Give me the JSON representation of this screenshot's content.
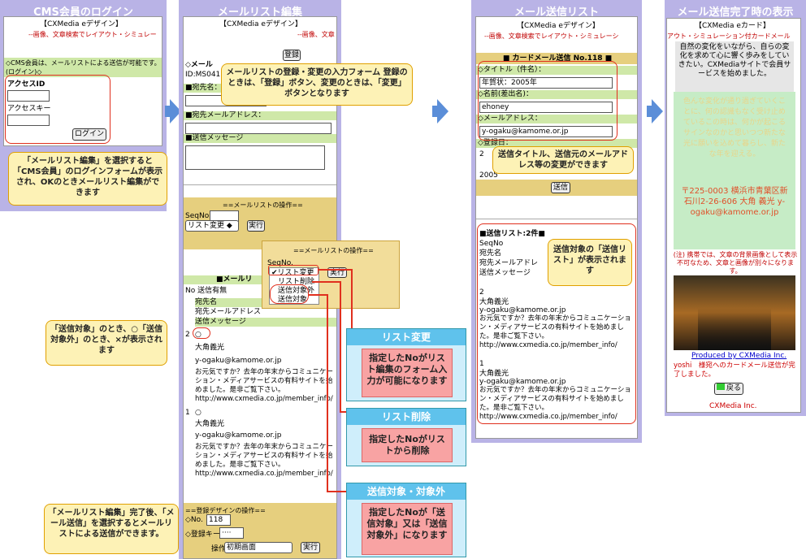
{
  "col1": {
    "title": "CMS会員のログイン",
    "header": "【CXMedia eデザイン】",
    "subheader": "--画像、文章検索でレイアウト・シミュレー",
    "notice": "◇CMS会員は、メールリストによる送信が可能です。(ログイン)◇",
    "access_id_label": "アクセスID",
    "access_key_label": "アクセスキー",
    "login_button": "ログイン",
    "callout": "「メールリスト編集」を選択すると「CMS会員」のログインフォームが表示され、OKのときメールリスト編集ができます"
  },
  "col2": {
    "title": "メールリスト編集",
    "header": "【CXMedia eデザイン】",
    "subheader": "--画像、文章",
    "register_button": "登録",
    "maillist_label": "◇メール",
    "id_text": "ID:MS041",
    "name_label": "■宛先名：",
    "email_label": "■宛先メールアドレス：",
    "message_label": "■送信メッセージ",
    "callout": "メールリストの登録・変更の入力フォーム 登録のときは、「登録」ボタン、変更のときは、「変更」ボタンとなります",
    "ops_title": "==メールリストの操作==",
    "seqno_label": "SeqNo.",
    "select_value": "リスト変更",
    "exec_button": "実行",
    "list_header": "■メールリ",
    "col_header": "No 送信有無",
    "col_name": "宛先名",
    "col_email": "宛先メールアドレス",
    "col_msg": "送信メッセージ",
    "entries": [
      {
        "no": "2",
        "mark": "○",
        "name": "大角義光",
        "email": "y-ogaku@kamome.or.jp",
        "body": "お元気ですか？去年の年末からコミュニケーション・メディアサービスの有料サイトを始めました。是非ご覧下さい。http://www.cxmedia.co.jp/member_info/"
      },
      {
        "no": "1",
        "mark": "○",
        "name": "大角義光",
        "email": "y-ogaku@kamome.or.jp",
        "body": "お元気ですか？去年の年末からコミュニケーション・メディアサービスの有料サイトを始めました。是非ご覧下さい。http://www.cxmedia.co.jp/member_info/"
      }
    ],
    "footer_title": "==登録デザインの操作==",
    "footer_no_label": "◇No.",
    "footer_no_value": "118",
    "footer_key_label": "◇登録キー",
    "footer_key_value": "····",
    "footer_op_label": "操作",
    "footer_select": "初期画面",
    "footer_exec": "実行",
    "callout_mark": "「送信対象」のとき、○「送信対象外」のとき、×が表示されます",
    "callout_send": "「メールリスト編集」完了後、「メール送信」を選択するとメールリストによる送信ができます。"
  },
  "popup": {
    "title": "==メールリストの操作==",
    "seqno_label": "SeqNo.",
    "options": [
      "✔リスト変更",
      "リスト削除",
      "送信対象外",
      "送信対象"
    ],
    "exec_button": "実行"
  },
  "info": [
    {
      "title": "リスト変更",
      "body": "指定したNoがリスト編集のフォーム入力が可能になります"
    },
    {
      "title": "リスト削除",
      "body": "指定したNoがリストから削除"
    },
    {
      "title": "送信対象・対象外",
      "body": "指定したNoが「送信対象」又は「送信対象外」になります"
    }
  ],
  "col3": {
    "title": "メール送信リスト",
    "header": "【CXMedia eデザイン】",
    "subheader": "--画像、文章検索でレイアウト・シミュレーシ",
    "bar": "■ カードメール送信 No.118 ■",
    "subject_label": "◇タイトル（件名）：",
    "subject_value": "年賀状：2005年",
    "sender_label": "◇名前(差出名)：",
    "sender_value": "ehoney",
    "email_label": "◇メールアドレス：",
    "email_value": "y-ogaku@kamome.or.jp",
    "reg_label": "◇登録日：",
    "reg_value": "2",
    "date_partial": "2005",
    "send_button": "送信",
    "callout1": "送信タイトル、送信元のメールアドレス等の変更ができます",
    "list_header": "■送信リスト:2件■",
    "hdr_seq": "SeqNo",
    "hdr_name": "宛先名",
    "hdr_email": "宛先メールアドレ",
    "hdr_msg": "送信メッセージ",
    "callout2": "送信対象の「送信リスト」が表示されます",
    "entries": [
      {
        "no": "2",
        "name": "大角義光",
        "email": "y-ogaku@kamome.or.jp",
        "body": "お元気ですか？去年の年末からコミュニケーション・メディアサービスの有料サイトを始めました。是非ご覧下さい。http://www.cxmedia.co.jp/member_info/"
      },
      {
        "no": "1",
        "name": "大角義光",
        "email": "y-ogaku@kamome.or.jp",
        "body": "お元気ですか？去年の年末からコミュニケーション・メディアサービスの有料サイトを始めました。是非ご覧下さい。http://www.cxmedia.co.jp/member_info/"
      }
    ]
  },
  "col4": {
    "title": "メール送信完了時の表示",
    "header": "【CXMedia eカード】",
    "subheader": "アウト・シミュレーション付カードメール",
    "intro": "自然の変化をいながら、自らの変化を求めて心に響く歩みをしていきたい。CXMediaサイトで会員サービスを始めました。",
    "poem": "色んな変化が通り過ぎていくことに、何の認識もなく受け止めているこの時は、何かが起こるサインなのかと思いつつ新たな光に願いを込めて暮らし、新たな年を迎える。",
    "address": "〒225-0003 横浜市青葉区新石川2-26-606 大角 義光 y-ogaku@kamome.or.jp",
    "note": "(注) 携帯では、文章の背景画像として表示不可なため、文章と画像が別々になります。",
    "produced": "Produced by CXMedia Inc.",
    "done": "yoshi　様宛へのカードメール送信が完了しました。",
    "back_button": "戻る",
    "footer": "CXMedia Inc."
  },
  "colors": {
    "col_bg": "#b9b3e6",
    "green_bar": "#cfe8a8",
    "olive_bar": "#e6cf7e",
    "callout_bg": "#fdf2b6",
    "red_outline": "#e0301e",
    "arrow": "#5b8ed8"
  }
}
